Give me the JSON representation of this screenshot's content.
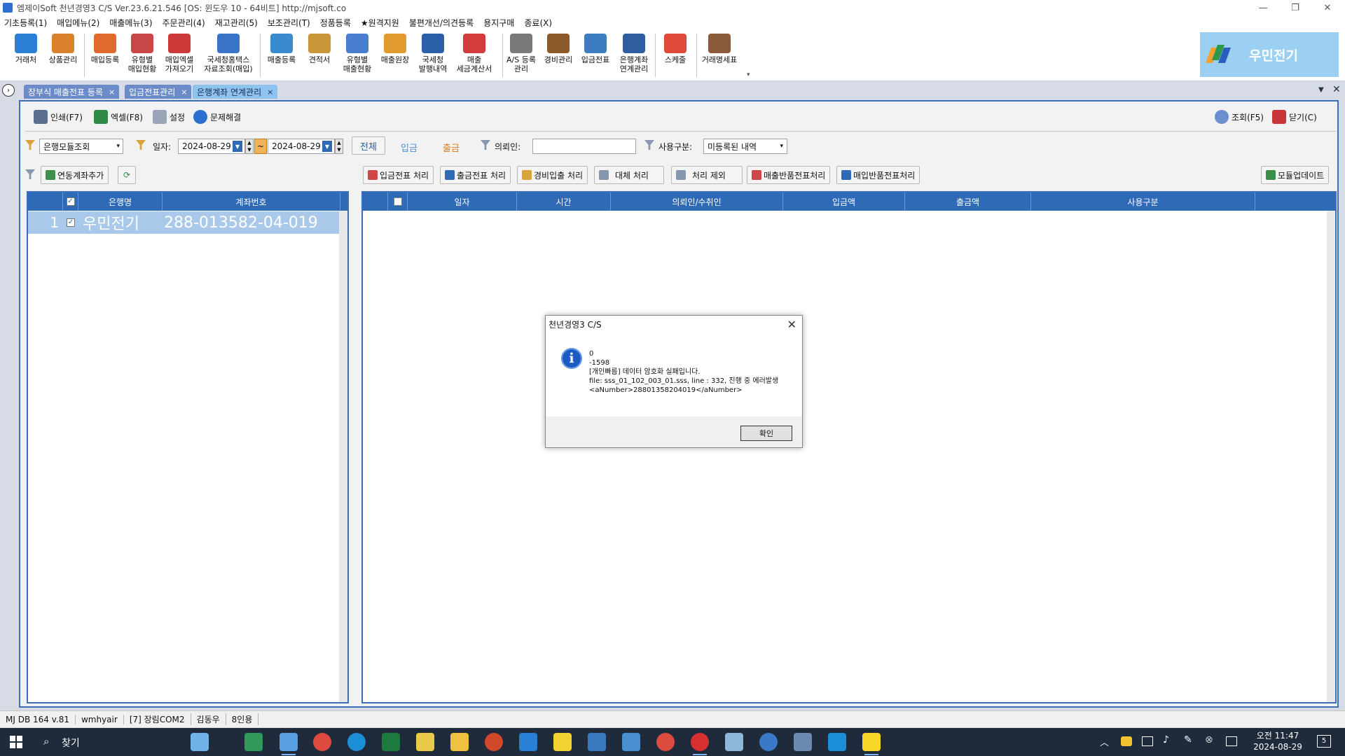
{
  "window": {
    "title": "엠제이Soft 천년경영3 C/S  Ver.23.6.21.546  [OS: 윈도우 10 - 64비트]   http://mjsoft.co",
    "controls": [
      "—",
      "❐",
      "✕"
    ]
  },
  "menu": [
    "기초등록(1)",
    "매입메뉴(2)",
    "매출메뉴(3)",
    "주문관리(4)",
    "재고관리(5)",
    "보조관리(T)",
    "정품등록",
    "★원격지원",
    "불편개선/의견등록",
    "용지구매",
    "종료(X)"
  ],
  "toolbar": {
    "buttons": [
      {
        "label": "거래처",
        "color": "#2c7fd6"
      },
      {
        "label": "상품관리",
        "color": "#d9822b"
      },
      {
        "label": "매입등록",
        "color": "#e06a2e"
      },
      {
        "label": "유형별\n매입현황",
        "color": "#c84646"
      },
      {
        "label": "매입엑셀\n가져오기",
        "color": "#cc3a3a"
      },
      {
        "label": "국세청홈택스\n자료조회(매입)",
        "color": "#3a74c9"
      },
      {
        "label": "매출등록",
        "color": "#3a8ad0"
      },
      {
        "label": "견적서",
        "color": "#c9963a"
      },
      {
        "label": "유형별\n매출현황",
        "color": "#4a7fd0"
      },
      {
        "label": "매출원장",
        "color": "#e09a2e"
      },
      {
        "label": "국세청\n발행내역",
        "color": "#2b5fa8"
      },
      {
        "label": "매출\n세금계산서",
        "color": "#d23c3c"
      },
      {
        "label": "A/S 등록\n관리",
        "color": "#7a7a7a"
      },
      {
        "label": "경비관리",
        "color": "#8a5a2b"
      },
      {
        "label": "입금전표",
        "color": "#3c7cc0"
      },
      {
        "label": "은행계좌\n연계관리",
        "color": "#2f5ea0"
      },
      {
        "label": "스케줄",
        "color": "#e04a3a"
      },
      {
        "label": "거래명세표",
        "color": "#8a5a3a"
      }
    ],
    "brand": "우민전기"
  },
  "tabs": [
    {
      "label": "장부식 매출전표 등록",
      "active": false
    },
    {
      "label": "입금전표관리",
      "active": false
    },
    {
      "label": "은행계좌 연계관리",
      "active": true
    }
  ],
  "actions": {
    "print": "인쇄(F7)",
    "excel": "엑셀(F8)",
    "settings": "설정",
    "troubleshoot": "문제해결",
    "search": "조회(F5)",
    "close": "닫기(C)"
  },
  "filters": {
    "module": "은행모듈조회",
    "date_label": "일자:",
    "date_from": "2024-08-29",
    "date_to": "2024-08-29",
    "range_sep": "~",
    "all": "전체",
    "deposit": "입금",
    "withdraw": "출금",
    "client_label": "의뢰인:",
    "client_value": "",
    "usage_label": "사용구분:",
    "usage_value": "미등록된 내역"
  },
  "buttons": {
    "add_account": "연동계좌추가",
    "deposit_slip": "입금전표 처리",
    "withdraw_slip": "출금전표 처리",
    "expense": "경비입출 처리",
    "substitute": "대체 처리",
    "exclude": "처리 제외",
    "sales_return": "매출반품전표처리",
    "purchase_return": "매입반품전표처리",
    "module_update": "모듈업데이트"
  },
  "account_grid": {
    "headers": [
      "은행명",
      "계좌번호"
    ],
    "rows": [
      {
        "index": "1",
        "bank": "우민전기",
        "account": "288-013582-04-019",
        "checked": true
      }
    ]
  },
  "tx_grid": {
    "headers": [
      "일자",
      "시간",
      "의뢰인/수취인",
      "입금액",
      "출금액",
      "사용구분"
    ]
  },
  "dialog": {
    "title": "천년경영3 C/S",
    "lines": [
      "0",
      "-1598",
      "[개인빠름] 데이터 암호화 실패입니다.",
      "file: sss_01_102_003_01.sss, line : 332, 진행 중 에러발생",
      "<aNumber>28801358204019</aNumber>"
    ],
    "ok": "확인"
  },
  "status": [
    "MJ DB 164 v.81",
    "wmhyair",
    "[7] 장림COM2",
    "김동우",
    "8인용"
  ],
  "taskbar": {
    "search": "찾기",
    "time": "오전 11:47",
    "date": "2024-08-29",
    "notif_count": "5"
  }
}
